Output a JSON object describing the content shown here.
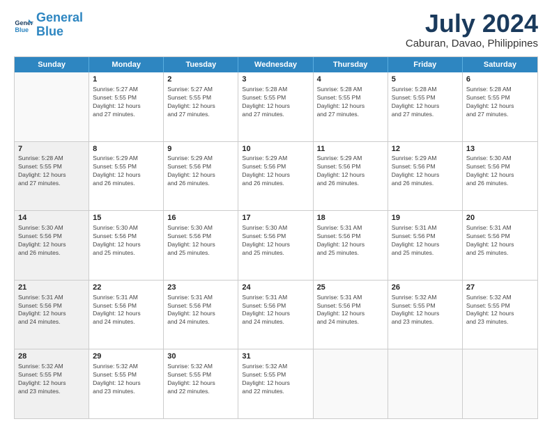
{
  "logo": {
    "line1": "General",
    "line2": "Blue"
  },
  "title": "July 2024",
  "subtitle": "Caburan, Davao, Philippines",
  "days": [
    "Sunday",
    "Monday",
    "Tuesday",
    "Wednesday",
    "Thursday",
    "Friday",
    "Saturday"
  ],
  "weeks": [
    [
      {
        "day": "",
        "info": "",
        "empty": true
      },
      {
        "day": "1",
        "info": "Sunrise: 5:27 AM\nSunset: 5:55 PM\nDaylight: 12 hours\nand 27 minutes.",
        "empty": false
      },
      {
        "day": "2",
        "info": "Sunrise: 5:27 AM\nSunset: 5:55 PM\nDaylight: 12 hours\nand 27 minutes.",
        "empty": false
      },
      {
        "day": "3",
        "info": "Sunrise: 5:28 AM\nSunset: 5:55 PM\nDaylight: 12 hours\nand 27 minutes.",
        "empty": false
      },
      {
        "day": "4",
        "info": "Sunrise: 5:28 AM\nSunset: 5:55 PM\nDaylight: 12 hours\nand 27 minutes.",
        "empty": false
      },
      {
        "day": "5",
        "info": "Sunrise: 5:28 AM\nSunset: 5:55 PM\nDaylight: 12 hours\nand 27 minutes.",
        "empty": false
      },
      {
        "day": "6",
        "info": "Sunrise: 5:28 AM\nSunset: 5:55 PM\nDaylight: 12 hours\nand 27 minutes.",
        "empty": false
      }
    ],
    [
      {
        "day": "7",
        "info": "Sunrise: 5:28 AM\nSunset: 5:55 PM\nDaylight: 12 hours\nand 27 minutes.",
        "empty": false,
        "shaded": true
      },
      {
        "day": "8",
        "info": "Sunrise: 5:29 AM\nSunset: 5:55 PM\nDaylight: 12 hours\nand 26 minutes.",
        "empty": false
      },
      {
        "day": "9",
        "info": "Sunrise: 5:29 AM\nSunset: 5:56 PM\nDaylight: 12 hours\nand 26 minutes.",
        "empty": false
      },
      {
        "day": "10",
        "info": "Sunrise: 5:29 AM\nSunset: 5:56 PM\nDaylight: 12 hours\nand 26 minutes.",
        "empty": false
      },
      {
        "day": "11",
        "info": "Sunrise: 5:29 AM\nSunset: 5:56 PM\nDaylight: 12 hours\nand 26 minutes.",
        "empty": false
      },
      {
        "day": "12",
        "info": "Sunrise: 5:29 AM\nSunset: 5:56 PM\nDaylight: 12 hours\nand 26 minutes.",
        "empty": false
      },
      {
        "day": "13",
        "info": "Sunrise: 5:30 AM\nSunset: 5:56 PM\nDaylight: 12 hours\nand 26 minutes.",
        "empty": false
      }
    ],
    [
      {
        "day": "14",
        "info": "Sunrise: 5:30 AM\nSunset: 5:56 PM\nDaylight: 12 hours\nand 26 minutes.",
        "empty": false,
        "shaded": true
      },
      {
        "day": "15",
        "info": "Sunrise: 5:30 AM\nSunset: 5:56 PM\nDaylight: 12 hours\nand 25 minutes.",
        "empty": false
      },
      {
        "day": "16",
        "info": "Sunrise: 5:30 AM\nSunset: 5:56 PM\nDaylight: 12 hours\nand 25 minutes.",
        "empty": false
      },
      {
        "day": "17",
        "info": "Sunrise: 5:30 AM\nSunset: 5:56 PM\nDaylight: 12 hours\nand 25 minutes.",
        "empty": false
      },
      {
        "day": "18",
        "info": "Sunrise: 5:31 AM\nSunset: 5:56 PM\nDaylight: 12 hours\nand 25 minutes.",
        "empty": false
      },
      {
        "day": "19",
        "info": "Sunrise: 5:31 AM\nSunset: 5:56 PM\nDaylight: 12 hours\nand 25 minutes.",
        "empty": false
      },
      {
        "day": "20",
        "info": "Sunrise: 5:31 AM\nSunset: 5:56 PM\nDaylight: 12 hours\nand 25 minutes.",
        "empty": false
      }
    ],
    [
      {
        "day": "21",
        "info": "Sunrise: 5:31 AM\nSunset: 5:56 PM\nDaylight: 12 hours\nand 24 minutes.",
        "empty": false,
        "shaded": true
      },
      {
        "day": "22",
        "info": "Sunrise: 5:31 AM\nSunset: 5:56 PM\nDaylight: 12 hours\nand 24 minutes.",
        "empty": false
      },
      {
        "day": "23",
        "info": "Sunrise: 5:31 AM\nSunset: 5:56 PM\nDaylight: 12 hours\nand 24 minutes.",
        "empty": false
      },
      {
        "day": "24",
        "info": "Sunrise: 5:31 AM\nSunset: 5:56 PM\nDaylight: 12 hours\nand 24 minutes.",
        "empty": false
      },
      {
        "day": "25",
        "info": "Sunrise: 5:31 AM\nSunset: 5:56 PM\nDaylight: 12 hours\nand 24 minutes.",
        "empty": false
      },
      {
        "day": "26",
        "info": "Sunrise: 5:32 AM\nSunset: 5:55 PM\nDaylight: 12 hours\nand 23 minutes.",
        "empty": false
      },
      {
        "day": "27",
        "info": "Sunrise: 5:32 AM\nSunset: 5:55 PM\nDaylight: 12 hours\nand 23 minutes.",
        "empty": false
      }
    ],
    [
      {
        "day": "28",
        "info": "Sunrise: 5:32 AM\nSunset: 5:55 PM\nDaylight: 12 hours\nand 23 minutes.",
        "empty": false,
        "shaded": true
      },
      {
        "day": "29",
        "info": "Sunrise: 5:32 AM\nSunset: 5:55 PM\nDaylight: 12 hours\nand 23 minutes.",
        "empty": false
      },
      {
        "day": "30",
        "info": "Sunrise: 5:32 AM\nSunset: 5:55 PM\nDaylight: 12 hours\nand 22 minutes.",
        "empty": false
      },
      {
        "day": "31",
        "info": "Sunrise: 5:32 AM\nSunset: 5:55 PM\nDaylight: 12 hours\nand 22 minutes.",
        "empty": false
      },
      {
        "day": "",
        "info": "",
        "empty": true
      },
      {
        "day": "",
        "info": "",
        "empty": true
      },
      {
        "day": "",
        "info": "",
        "empty": true
      }
    ]
  ]
}
